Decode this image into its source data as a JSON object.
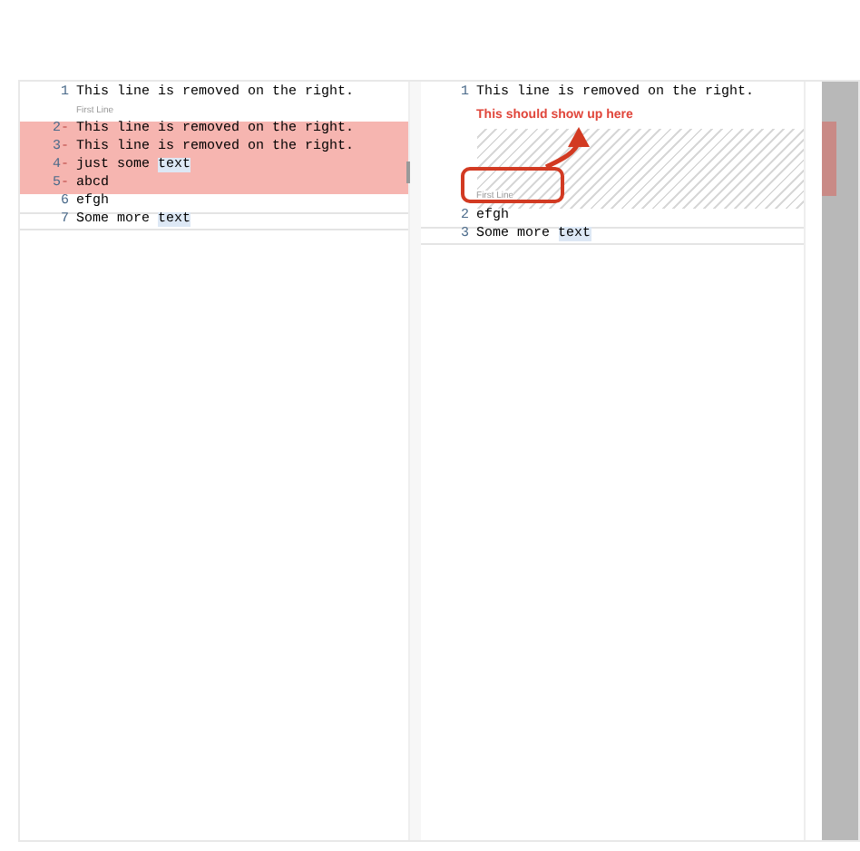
{
  "left_pane": {
    "lines": [
      {
        "kind": "code",
        "number": "1",
        "removed": false,
        "current": false,
        "segments": [
          {
            "text": "This line is removed on the right.",
            "highlighted": false
          }
        ]
      },
      {
        "kind": "label",
        "text": "First Line"
      },
      {
        "kind": "code",
        "number": "2",
        "sign": "-",
        "removed": true,
        "current": false,
        "segments": [
          {
            "text": "This line is removed on the right.",
            "highlighted": false
          }
        ]
      },
      {
        "kind": "code",
        "number": "3",
        "sign": "-",
        "removed": true,
        "current": false,
        "segments": [
          {
            "text": "This line is removed on the right.",
            "highlighted": false
          }
        ]
      },
      {
        "kind": "code",
        "number": "4",
        "sign": "-",
        "removed": true,
        "current": false,
        "segments": [
          {
            "text": "just some ",
            "highlighted": false
          },
          {
            "text": "text",
            "highlighted": true
          }
        ]
      },
      {
        "kind": "code",
        "number": "5",
        "sign": "-",
        "removed": true,
        "current": false,
        "segments": [
          {
            "text": "abcd",
            "highlighted": false
          }
        ]
      },
      {
        "kind": "code",
        "number": "6",
        "removed": false,
        "current": false,
        "segments": [
          {
            "text": "efgh",
            "highlighted": false
          }
        ]
      },
      {
        "kind": "code",
        "number": "7",
        "removed": false,
        "current": true,
        "segments": [
          {
            "text": "Some more ",
            "highlighted": false
          },
          {
            "text": "text",
            "highlighted": true
          }
        ]
      }
    ]
  },
  "right_pane": {
    "lines": [
      {
        "kind": "code",
        "number": "1",
        "removed": false,
        "current": false,
        "segments": [
          {
            "text": "This line is removed on the right.",
            "highlighted": false
          }
        ]
      },
      {
        "kind": "annotation",
        "text": "This should show up here"
      },
      {
        "kind": "gap",
        "label": "First Line"
      },
      {
        "kind": "code",
        "number": "2",
        "removed": false,
        "current": false,
        "segments": [
          {
            "text": "efgh",
            "highlighted": false
          }
        ]
      },
      {
        "kind": "code",
        "number": "3",
        "removed": false,
        "current": true,
        "segments": [
          {
            "text": "Some more ",
            "highlighted": false
          },
          {
            "text": "text",
            "highlighted": true
          }
        ]
      }
    ]
  }
}
